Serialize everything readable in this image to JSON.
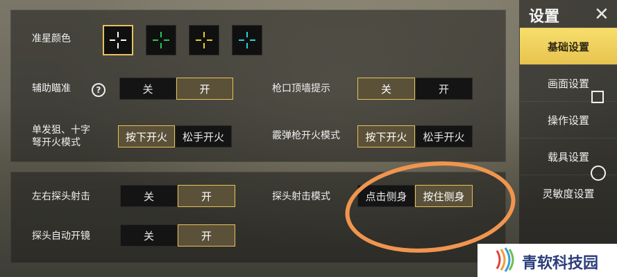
{
  "colors": {
    "accent": "#e7c25a",
    "active_tab": "#f0d45d",
    "annotation": "#f0954f",
    "brand_text": "#2a3c7a"
  },
  "crosshair": {
    "label": "准星颜色",
    "swatches": [
      {
        "name": "white",
        "color": "#ffffff",
        "selected": true
      },
      {
        "name": "green",
        "color": "#22cc55",
        "selected": false
      },
      {
        "name": "yellow",
        "color": "#e6d22a",
        "selected": false
      },
      {
        "name": "cyan",
        "color": "#2ad0e0",
        "selected": false
      }
    ]
  },
  "settings": {
    "aim_assist": {
      "label": "辅助瞄准",
      "help": "?",
      "off": "关",
      "on": "开",
      "selected": "on"
    },
    "muzzle_wall": {
      "label": "枪口顶墙提示",
      "off": "关",
      "on": "开",
      "selected": "off"
    },
    "single_fire": {
      "label_line1": "单发狙、十字",
      "label_line2": "弩开火模式",
      "press": "按下开火",
      "release": "松手开火",
      "selected": "press"
    },
    "shotgun_fire": {
      "label": "霰弹枪开火模式",
      "press": "按下开火",
      "release": "松手开火",
      "selected": "press"
    },
    "peek_fire": {
      "label": "左右探头射击",
      "off": "关",
      "on": "开",
      "selected": "on"
    },
    "peek_mode": {
      "label": "探头射击模式",
      "tap": "点击侧身",
      "hold": "按住侧身",
      "selected": "hold"
    },
    "peek_scope": {
      "label": "探头自动开镜",
      "off": "关",
      "on": "开",
      "selected": "on"
    }
  },
  "sidebar": {
    "title": "设置",
    "items": [
      {
        "label": "基础设置",
        "active": true
      },
      {
        "label": "画面设置",
        "active": false
      },
      {
        "label": "操作设置",
        "active": false
      },
      {
        "label": "载具设置",
        "active": false
      },
      {
        "label": "灵敏度设置",
        "active": false
      }
    ]
  },
  "watermark": {
    "text": "青软科技园"
  }
}
